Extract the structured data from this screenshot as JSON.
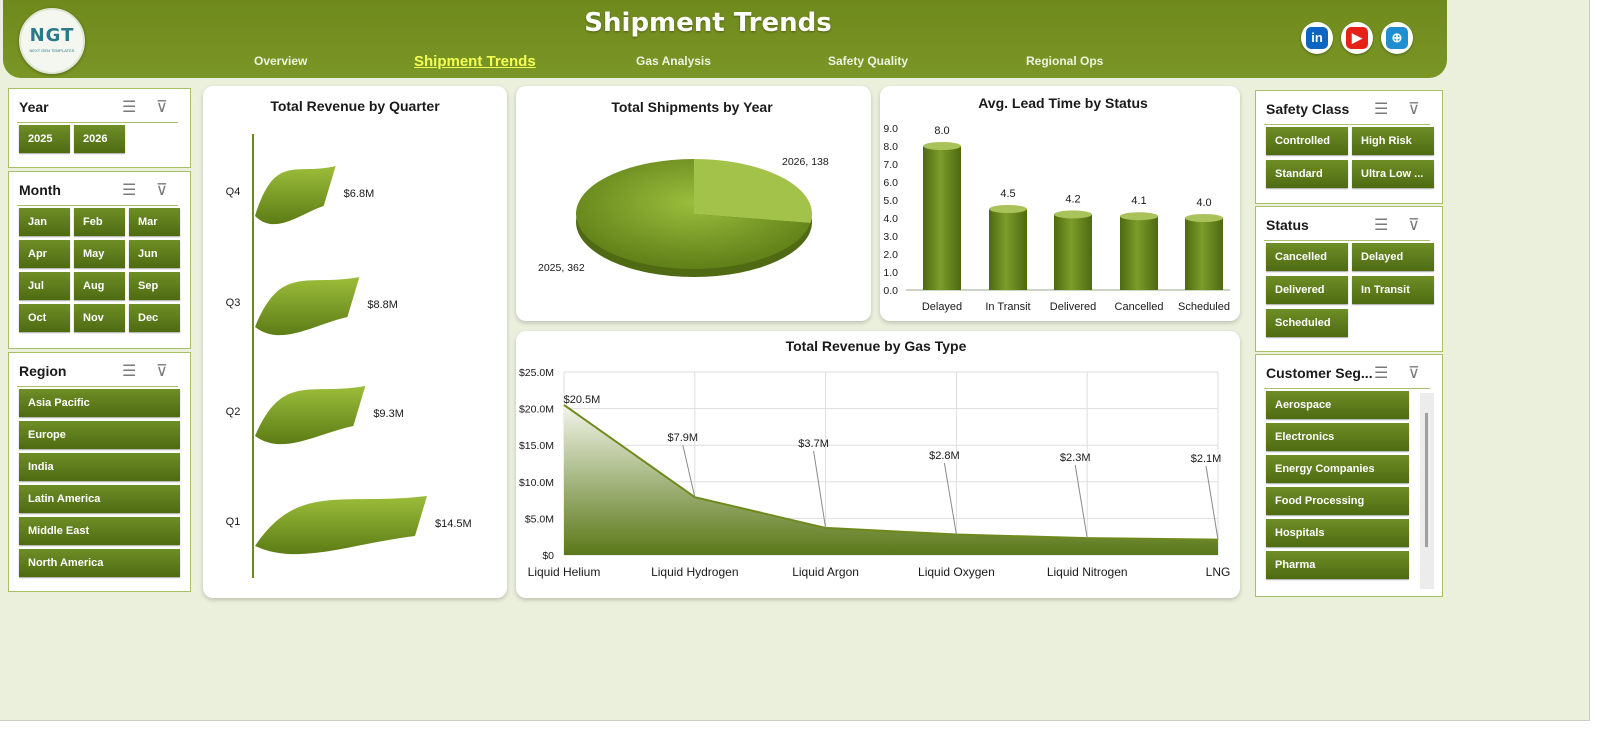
{
  "header": {
    "title": "Shipment Trends",
    "logo_text": "NGT",
    "logo_tagline": "NEXT GEN TEMPLATES",
    "nav": [
      {
        "label": "Overview",
        "active": false
      },
      {
        "label": "Shipment Trends",
        "active": true
      },
      {
        "label": "Gas Analysis",
        "active": false
      },
      {
        "label": "Safety Quality",
        "active": false
      },
      {
        "label": "Regional Ops",
        "active": false
      }
    ],
    "social": [
      {
        "name": "linkedin-icon",
        "glyph": "in",
        "color": "#0a66c2"
      },
      {
        "name": "youtube-icon",
        "glyph": "▶",
        "color": "#e62117"
      },
      {
        "name": "website-icon",
        "glyph": "⊕",
        "color": "#1f8fd1"
      }
    ]
  },
  "slicers": {
    "year": {
      "title": "Year",
      "items": [
        "2025",
        "2026"
      ]
    },
    "month": {
      "title": "Month",
      "items": [
        "Jan",
        "Feb",
        "Mar",
        "Apr",
        "May",
        "Jun",
        "Jul",
        "Aug",
        "Sep",
        "Oct",
        "Nov",
        "Dec"
      ]
    },
    "region": {
      "title": "Region",
      "items": [
        "Asia Pacific",
        "Europe",
        "India",
        "Latin America",
        "Middle East",
        "North America"
      ]
    },
    "safety_class": {
      "title": "Safety Class",
      "items": [
        "Controlled",
        "High Risk",
        "Standard",
        "Ultra Low ..."
      ]
    },
    "status": {
      "title": "Status",
      "items": [
        "Cancelled",
        "Delayed",
        "Delivered",
        "In Transit",
        "Scheduled"
      ]
    },
    "customer_segment": {
      "title": "Customer Seg...",
      "items": [
        "Aerospace",
        "Electronics",
        "Energy Companies",
        "Food Processing",
        "Hospitals",
        "Pharma"
      ]
    }
  },
  "colors": {
    "accent": "#6f8a1c",
    "button": "#5a7a1a",
    "background": "#ebf0dd",
    "active_nav": "#f4ff55"
  },
  "chart_data": [
    {
      "type": "bar",
      "title": "Total Revenue  by Quarter",
      "orientation": "horizontal",
      "categories": [
        "Q1",
        "Q2",
        "Q3",
        "Q4"
      ],
      "values": [
        14.5,
        9.3,
        8.8,
        6.8
      ],
      "labels": [
        "$14.5M",
        "$9.3M",
        "$8.8M",
        "$6.8M"
      ],
      "unit": "$M"
    },
    {
      "type": "pie",
      "title": "Total Shipments by Year",
      "categories": [
        "2025",
        "2026"
      ],
      "values": [
        362,
        138
      ],
      "labels": [
        "2025, 362",
        "2026, 138"
      ]
    },
    {
      "type": "bar",
      "title": "Avg. Lead Time by Status",
      "categories": [
        "Delayed",
        "In Transit",
        "Delivered",
        "Cancelled",
        "Scheduled"
      ],
      "values": [
        8.0,
        4.5,
        4.2,
        4.1,
        4.0
      ],
      "labels": [
        "8.0",
        "4.5",
        "4.2",
        "4.1",
        "4.0"
      ],
      "yticks": [
        "0.0",
        "1.0",
        "2.0",
        "3.0",
        "4.0",
        "5.0",
        "6.0",
        "7.0",
        "8.0",
        "9.0"
      ],
      "ylim": [
        0,
        9
      ]
    },
    {
      "type": "area",
      "title": "Total Revenue  by Gas Type",
      "categories": [
        "Liquid Helium",
        "Liquid Hydrogen",
        "Liquid Argon",
        "Liquid Oxygen",
        "Liquid Nitrogen",
        "LNG"
      ],
      "values": [
        20.5,
        7.9,
        3.7,
        2.8,
        2.3,
        2.1
      ],
      "labels": [
        "$20.5M",
        "$7.9M",
        "$3.7M",
        "$2.8M",
        "$2.3M",
        "$2.1M"
      ],
      "yticks": [
        "$0",
        "$5.0M",
        "$10.0M",
        "$15.0M",
        "$20.0M",
        "$25.0M"
      ],
      "ylim": [
        0,
        25
      ],
      "grid": true
    }
  ]
}
